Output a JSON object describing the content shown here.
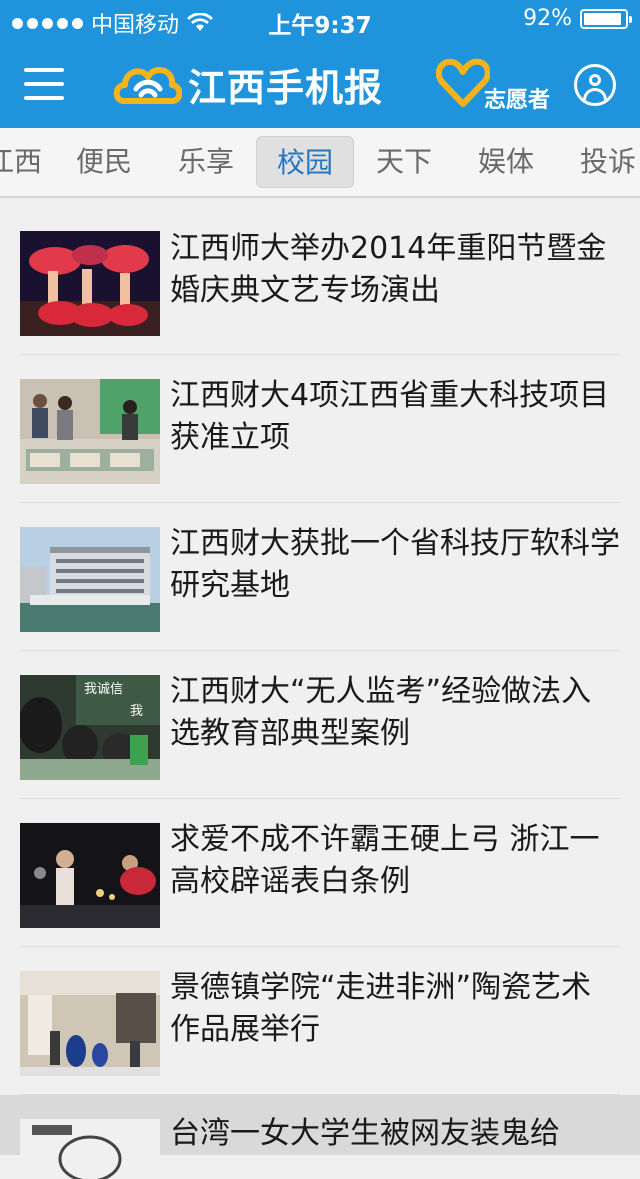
{
  "status_bar": {
    "carrier": "中国移动",
    "time": "上午9:37",
    "battery": "92%",
    "battery_level": 0.92
  },
  "nav": {
    "menu_icon": "hamburger-menu-icon",
    "logo_text": "江西手机报",
    "volunteer_label": "志愿者",
    "user_icon": "user-profile-icon",
    "colors": {
      "bar": "#1f93dc",
      "accent": "#f7b31c"
    }
  },
  "tabs": [
    {
      "label": "江西"
    },
    {
      "label": "便民"
    },
    {
      "label": "乐享"
    },
    {
      "label": "校园"
    },
    {
      "label": "天下"
    },
    {
      "label": "娱体"
    },
    {
      "label": "投诉"
    }
  ],
  "active_tab": "校园",
  "news": [
    {
      "title": "江西师大举办2014年重阳节暨金婚庆典文艺专场演出"
    },
    {
      "title": "江西财大4项江西省重大科技项目获准立项"
    },
    {
      "title": "江西财大获批一个省科技厅软科学研究基地"
    },
    {
      "title": "江西财大“无人监考”经验做法入选教育部典型案例"
    },
    {
      "title": "求爱不成不许霸王硬上弓 浙江一高校辟谣表白条例"
    },
    {
      "title": "景德镇学院“走进非洲”陶瓷艺术作品展举行"
    },
    {
      "title": "台湾一女大学生被网友装鬼给"
    }
  ]
}
